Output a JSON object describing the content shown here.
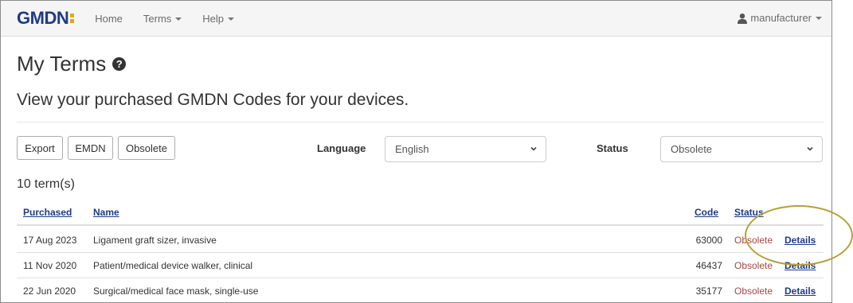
{
  "navbar": {
    "logo_main": "GMDN",
    "links": {
      "home": "Home",
      "terms": "Terms",
      "help": "Help"
    },
    "user": "manufacturer"
  },
  "page": {
    "title": "My Terms",
    "subtitle": "View your purchased GMDN Codes for your devices."
  },
  "toolbar": {
    "export": "Export",
    "emdn": "EMDN",
    "obsolete": "Obsolete",
    "language_label": "Language",
    "language_value": "English",
    "status_label": "Status",
    "status_value": "Obsolete"
  },
  "results": {
    "count": "10 term(s)"
  },
  "table": {
    "headers": {
      "purchased": "Purchased",
      "name": "Name",
      "code": "Code",
      "status": "Status"
    },
    "rows": [
      {
        "purchased": "17 Aug 2023",
        "name": "Ligament graft sizer, invasive",
        "code": "63000",
        "status": "Obsolete",
        "action": "Details"
      },
      {
        "purchased": "11 Nov 2020",
        "name": "Patient/medical device walker, clinical",
        "code": "46437",
        "status": "Obsolete",
        "action": "Details"
      },
      {
        "purchased": "22 Jun 2020",
        "name": "Surgical/medical face mask, single-use",
        "code": "35177",
        "status": "Obsolete",
        "action": "Details"
      }
    ]
  },
  "colors": {
    "brand": "#1d3b87",
    "accent": "#e8a900",
    "obsolete": "#a94442",
    "highlight": "#b8a034"
  }
}
